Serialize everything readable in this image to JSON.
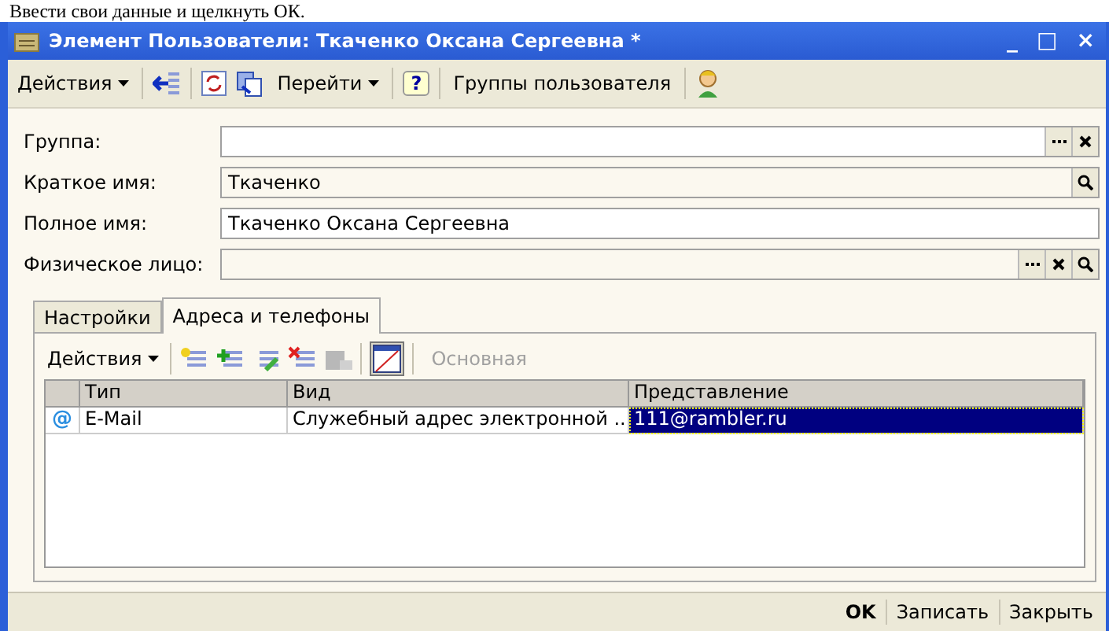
{
  "caption": "Ввести свои данные и щелкнуть ОК.",
  "window": {
    "title": "Элемент Пользователи: Ткаченко Оксана Сергеевна *",
    "controls": [
      "_",
      "□",
      "×"
    ]
  },
  "toolbar": {
    "actions": "Действия",
    "goto": "Перейти",
    "help": "?",
    "groups": "Группы пользователя"
  },
  "fields": [
    {
      "label": "Группа:",
      "choose_button": true,
      "clear_button": true,
      "search_button": false
    },
    {
      "label": "Краткое имя:",
      "value": "Ткаченко",
      "choose_button": false,
      "clear_button": false,
      "search_button": true
    },
    {
      "label": "Полное имя:",
      "value": "Ткаченко Оксана Сергеевна",
      "choose_button": false,
      "clear_button": false,
      "search_button": false
    },
    {
      "label": "Физическое лицо:",
      "choose_button": true,
      "clear_button": true,
      "search_button": true
    }
  ],
  "tabs": [
    {
      "label": "Настройки",
      "selected": false
    },
    {
      "label": "Адреса и телефоны",
      "selected": true
    }
  ],
  "panel_toolbar": {
    "actions": "Действия",
    "toggle_pressed": true,
    "main_button": {
      "label": "Основная",
      "disabled": true
    }
  },
  "table": {
    "columns": [
      "Тип",
      "Вид",
      "Представление"
    ],
    "rows": [
      {
        "icon": "@",
        "type": "E-Mail",
        "view": "Служебный адрес электронной ...",
        "presentation": "111@rambler.ru",
        "selected": true
      }
    ]
  },
  "footer": [
    {
      "label": "OK",
      "default": true
    },
    {
      "label": "Записать",
      "default": false
    },
    {
      "label": "Закрыть",
      "default": false
    }
  ]
}
